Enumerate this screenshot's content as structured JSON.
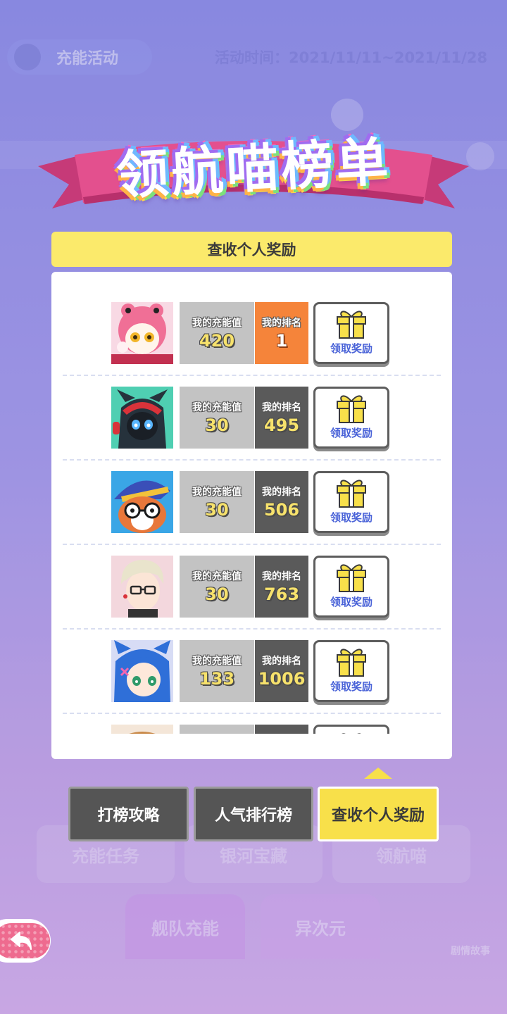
{
  "background": {
    "activity_label": "充能活动",
    "activity_time": "活动时间：2021/11/11~2021/11/28",
    "tiles": [
      "充能任务",
      "银河宝藏",
      "领航喵"
    ],
    "tabs": [
      "舰队充能",
      "异次元"
    ],
    "story_label": "剧情故事"
  },
  "banner": {
    "title": "领航喵榜单"
  },
  "header": {
    "title": "查收个人奖励"
  },
  "list": {
    "charge_label": "我的充能值",
    "rank_label": "我的排名",
    "claim_label": "领取奖励",
    "rows": [
      {
        "avatar": "pink-frog-hood-cat-avatar",
        "charge": "420",
        "rank": "1"
      },
      {
        "avatar": "black-hooded-cat-avatar",
        "charge": "30",
        "rank": "495"
      },
      {
        "avatar": "wizard-fox-glasses-avatar",
        "charge": "30",
        "rank": "506"
      },
      {
        "avatar": "blonde-glasses-man-avatar",
        "charge": "30",
        "rank": "763"
      },
      {
        "avatar": "blue-hair-cat-girl-avatar",
        "charge": "133",
        "rank": "1006"
      },
      {
        "avatar": "partial-avatar",
        "charge": "",
        "rank": ""
      }
    ]
  },
  "tabs": [
    {
      "label": "打榜攻略",
      "active": false
    },
    {
      "label": "人气排行榜",
      "active": false
    },
    {
      "label": "查收个人奖励",
      "active": true
    }
  ],
  "colors": {
    "accent_yellow": "#f8e04a",
    "rank_top": "#f5843a",
    "rank_default": "#5a5a5a",
    "claim_text": "#4a63d8",
    "banner_ribbon": "#e04a8a"
  }
}
